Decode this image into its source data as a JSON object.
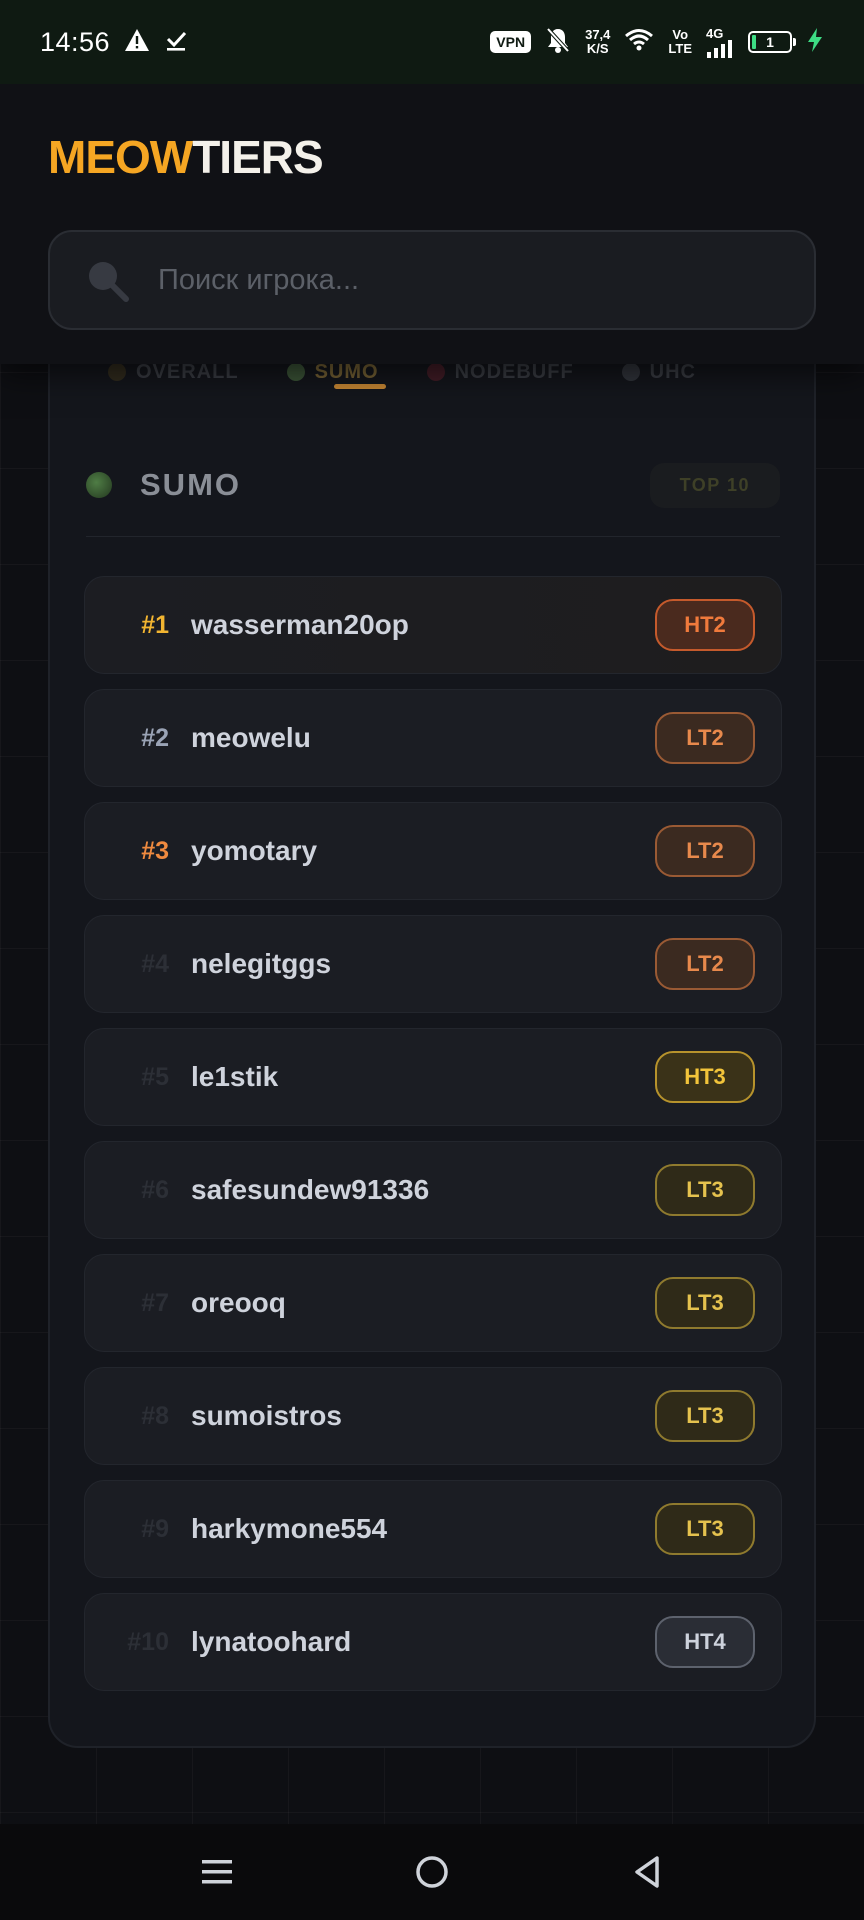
{
  "status_bar": {
    "time": "14:56",
    "vpn": "VPN",
    "net_speed_value": "37,4",
    "net_speed_unit": "K/S",
    "vo": "Vo",
    "lte": "LTE",
    "network": "4G",
    "battery": "1",
    "colors": {
      "bar_bg": "#0f1a12",
      "charging": "#3ddc84"
    }
  },
  "header": {
    "logo_part1": "MEOW",
    "logo_part2": "TIERS",
    "search_placeholder": "Поиск игрока...",
    "search_value": ""
  },
  "tabs": [
    {
      "label": "OVERALL",
      "icon": "crown-icon",
      "active": false
    },
    {
      "label": "SUMO",
      "icon": "slime-ball-icon",
      "active": true
    },
    {
      "label": "NODEBUFF",
      "icon": "potion-icon",
      "active": false
    },
    {
      "label": "UHC",
      "icon": "apple-icon",
      "active": false
    }
  ],
  "panel": {
    "title": "SUMO",
    "badge": "TOP 10"
  },
  "leaderboard": [
    {
      "rank": "#1",
      "name": "wasserman20op",
      "tier": "HT2"
    },
    {
      "rank": "#2",
      "name": "meowelu",
      "tier": "LT2"
    },
    {
      "rank": "#3",
      "name": "yomotary",
      "tier": "LT2"
    },
    {
      "rank": "#4",
      "name": "nelegitggs",
      "tier": "LT2"
    },
    {
      "rank": "#5",
      "name": "le1stik",
      "tier": "HT3"
    },
    {
      "rank": "#6",
      "name": "safesundew91336",
      "tier": "LT3"
    },
    {
      "rank": "#7",
      "name": "oreooq",
      "tier": "LT3"
    },
    {
      "rank": "#8",
      "name": "sumoistros",
      "tier": "LT3"
    },
    {
      "rank": "#9",
      "name": "harkymone554",
      "tier": "LT3"
    },
    {
      "rank": "#10",
      "name": "lynatoohard",
      "tier": "HT4"
    }
  ],
  "colors": {
    "accent": "#f5a623",
    "background": "#0b0c0f",
    "panel": "#14161c",
    "rank_gold": "#f2b531",
    "rank_silver": "#9aa3b5",
    "rank_bronze": "#ef8a3f"
  }
}
